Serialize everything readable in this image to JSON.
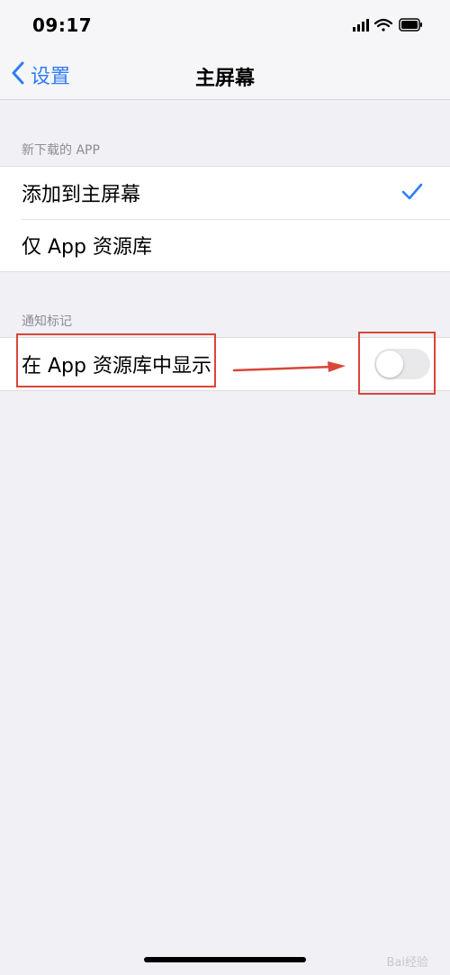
{
  "status_bar": {
    "time": "09:17"
  },
  "nav": {
    "back_label": "设置",
    "title": "主屏幕"
  },
  "sections": [
    {
      "header": "新下载的 APP",
      "rows": [
        {
          "label": "添加到主屏幕",
          "selected": true
        },
        {
          "label": "仅 App 资源库",
          "selected": false
        }
      ]
    },
    {
      "header": "通知标记",
      "rows": [
        {
          "label": "在 App 资源库中显示",
          "toggle_on": false
        }
      ]
    }
  ],
  "watermark": "Bai经验",
  "colors": {
    "accent": "#2f7df6",
    "annotation": "#d9463a",
    "toggle_off": "#e9e9eb"
  }
}
